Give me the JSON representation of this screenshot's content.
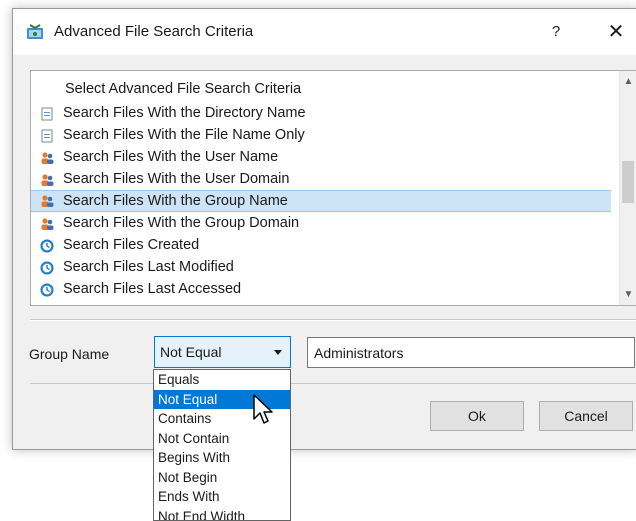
{
  "dialog": {
    "title": "Advanced File Search Criteria",
    "help_label": "?",
    "close_label": "✕"
  },
  "list": {
    "header": "Select Advanced File Search Criteria",
    "items": [
      {
        "label": "Search Files With the Directory Name",
        "icon": "document-icon",
        "selected": false
      },
      {
        "label": "Search Files With the File Name Only",
        "icon": "document-icon",
        "selected": false
      },
      {
        "label": "Search Files With the User Name",
        "icon": "users-icon",
        "selected": false
      },
      {
        "label": "Search Files With the User Domain",
        "icon": "users-icon",
        "selected": false
      },
      {
        "label": "Search Files With the Group Name",
        "icon": "users-icon",
        "selected": true
      },
      {
        "label": "Search Files With the Group Domain",
        "icon": "users-icon",
        "selected": false
      },
      {
        "label": "Search Files Created",
        "icon": "clock-icon",
        "selected": false
      },
      {
        "label": "Search Files Last Modified",
        "icon": "clock-icon",
        "selected": false
      },
      {
        "label": "Search Files Last Accessed",
        "icon": "clock-icon",
        "selected": false
      }
    ]
  },
  "criteria": {
    "field_label": "Group Name",
    "operator_value": "Not Equal",
    "value": "Administrators"
  },
  "operator_options": [
    "Equals",
    "Not Equal",
    "Contains",
    "Not Contain",
    "Begins With",
    "Not Begin",
    "Ends With",
    "Not End Width"
  ],
  "operator_selected_index": 1,
  "buttons": {
    "ok_label": "Ok",
    "cancel_label": "Cancel"
  },
  "colors": {
    "accent": "#0078d7",
    "selection_bg": "#cde4f7",
    "dialog_bg": "#f0f0f0"
  }
}
